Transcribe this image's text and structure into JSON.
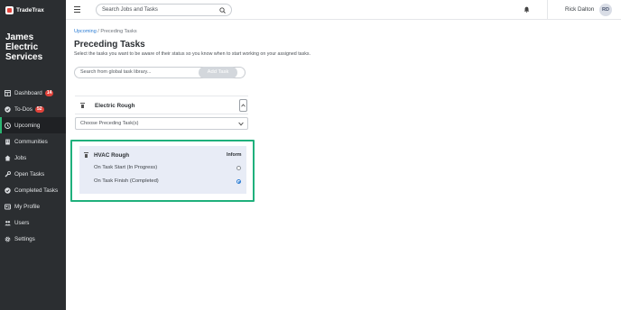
{
  "brand": {
    "name": "TradeTrax"
  },
  "company": {
    "name": "James Electric Services"
  },
  "sidebar": {
    "items": [
      {
        "label": "Dashboard",
        "icon": "dashboard-icon",
        "badge": "14"
      },
      {
        "label": "To-Dos",
        "icon": "todo-icon",
        "badge": "52"
      },
      {
        "label": "Upcoming",
        "icon": "upcoming-icon",
        "active": true
      },
      {
        "label": "Communities",
        "icon": "building-icon"
      },
      {
        "label": "Jobs",
        "icon": "home-icon"
      },
      {
        "label": "Open Tasks",
        "icon": "wrench-icon"
      },
      {
        "label": "Completed Tasks",
        "icon": "check-circle-icon"
      },
      {
        "label": "My Profile",
        "icon": "profile-icon"
      },
      {
        "label": "Users",
        "icon": "users-icon"
      },
      {
        "label": "Settings",
        "icon": "gear-icon"
      }
    ]
  },
  "topbar": {
    "search_placeholder": "Search Jobs and Tasks",
    "user_name": "Rick Dalton",
    "user_initials": "RD"
  },
  "main": {
    "breadcrumb": {
      "parent": "Upcoming",
      "separator": " / ",
      "current": "Preceding Tasks"
    },
    "title": "Preceding Tasks",
    "subtitle": "Select the tasks you want to be aware of their status so you know when to start working on your assigned tasks.",
    "library_search_placeholder": "Search from global task library...",
    "add_task_label": "Add Task",
    "task_card": {
      "title": "Electric Rough",
      "select_placeholder": "Choose Preceding Task(s)"
    },
    "preceding_card": {
      "title": "HVAC Rough",
      "inform_label": "Inform",
      "options": [
        {
          "label": "On Task Start (In Progress)",
          "selected": false
        },
        {
          "label": "On Task Finish (Completed)",
          "selected": true
        }
      ]
    }
  },
  "colors": {
    "sidebar_bg": "#2b2e31",
    "active_accent": "#2bb673",
    "badge": "#e2433b",
    "link": "#2b7cd3",
    "highlight_outline": "#1fb07c",
    "card_bg": "#e8ecf6"
  }
}
